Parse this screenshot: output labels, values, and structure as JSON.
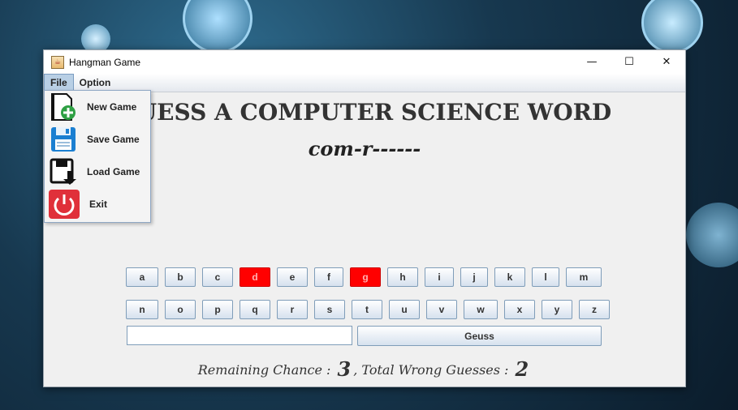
{
  "window": {
    "title": "Hangman Game"
  },
  "menubar": {
    "file": "File",
    "option": "Option"
  },
  "file_menu": [
    {
      "label": "New Game",
      "icon": "new-game-icon"
    },
    {
      "label": "Save Game",
      "icon": "floppy-save-icon"
    },
    {
      "label": "Load Game",
      "icon": "floppy-load-icon"
    },
    {
      "label": "Exit",
      "icon": "power-icon"
    }
  ],
  "game": {
    "heading": "GUESS A COMPUTER SCIENCE WORD",
    "word": "com-r------",
    "letters_row1": [
      "a",
      "b",
      "c",
      "d",
      "e",
      "f",
      "g",
      "h",
      "i",
      "j",
      "k",
      "l",
      "m"
    ],
    "letters_row2": [
      "n",
      "o",
      "p",
      "q",
      "r",
      "s",
      "t",
      "u",
      "v",
      "w",
      "x",
      "y",
      "z"
    ],
    "used_letters": [
      "d",
      "g"
    ],
    "guess_input_value": "",
    "guess_button": "Geuss",
    "remaining_label": "Remaining Chance :",
    "remaining_value": "3",
    "wrong_label": ", Total Wrong Guesses :",
    "wrong_value": "2"
  },
  "colors": {
    "used_key": "#ff0000",
    "accent": "#b8cfe5"
  }
}
